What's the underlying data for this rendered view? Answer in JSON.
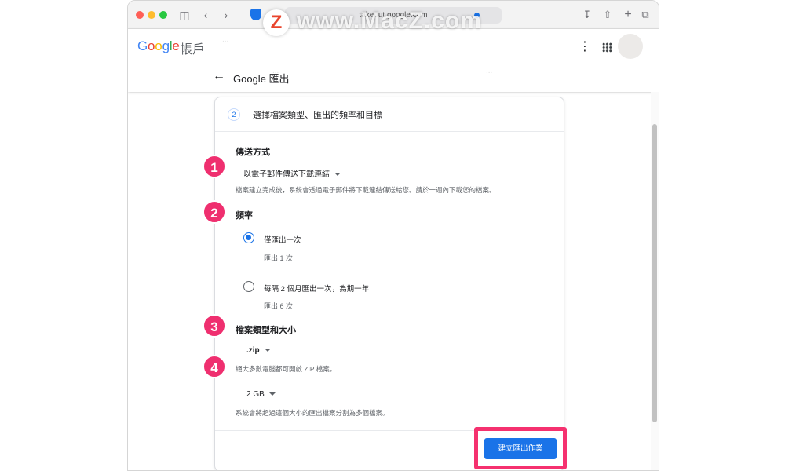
{
  "browser": {
    "url": "takeout.google.com"
  },
  "header": {
    "logo_text": "Google",
    "logo_suffix": "帳戶",
    "page_title": "Google 匯出"
  },
  "step": {
    "number": "2",
    "title": "選擇檔案類型、匯出的頻率和目標"
  },
  "delivery": {
    "title": "傳送方式",
    "selected": "以電子郵件傳送下載連結",
    "help": "檔案建立完成後，系統會透過電子郵件將下載連結傳送給您。請於一週內下載您的檔案。"
  },
  "frequency": {
    "title": "頻率",
    "options": [
      {
        "label": "僅匯出一次",
        "sub": "匯出 1 次",
        "checked": true
      },
      {
        "label": "每隔 2 個月匯出一次，為期一年",
        "sub": "匯出 6 次",
        "checked": false
      }
    ]
  },
  "file_type": {
    "title": "檔案類型和大小",
    "selected": ".zip",
    "help": "絕大多數電腦都可開啟 ZIP 檔案。"
  },
  "file_size": {
    "selected": "2 GB",
    "help": "系統會將超過這個大小的匯出檔案分割為多個檔案。"
  },
  "actions": {
    "create_export": "建立匯出作業"
  },
  "annotations": [
    "1",
    "2",
    "3",
    "4"
  ],
  "watermark": {
    "logo": "Z",
    "text": "www.MacZ.com"
  },
  "colors": {
    "accent": "#1a73e8",
    "annotation": "#ef2f6f",
    "highlight": "#f5316f"
  }
}
